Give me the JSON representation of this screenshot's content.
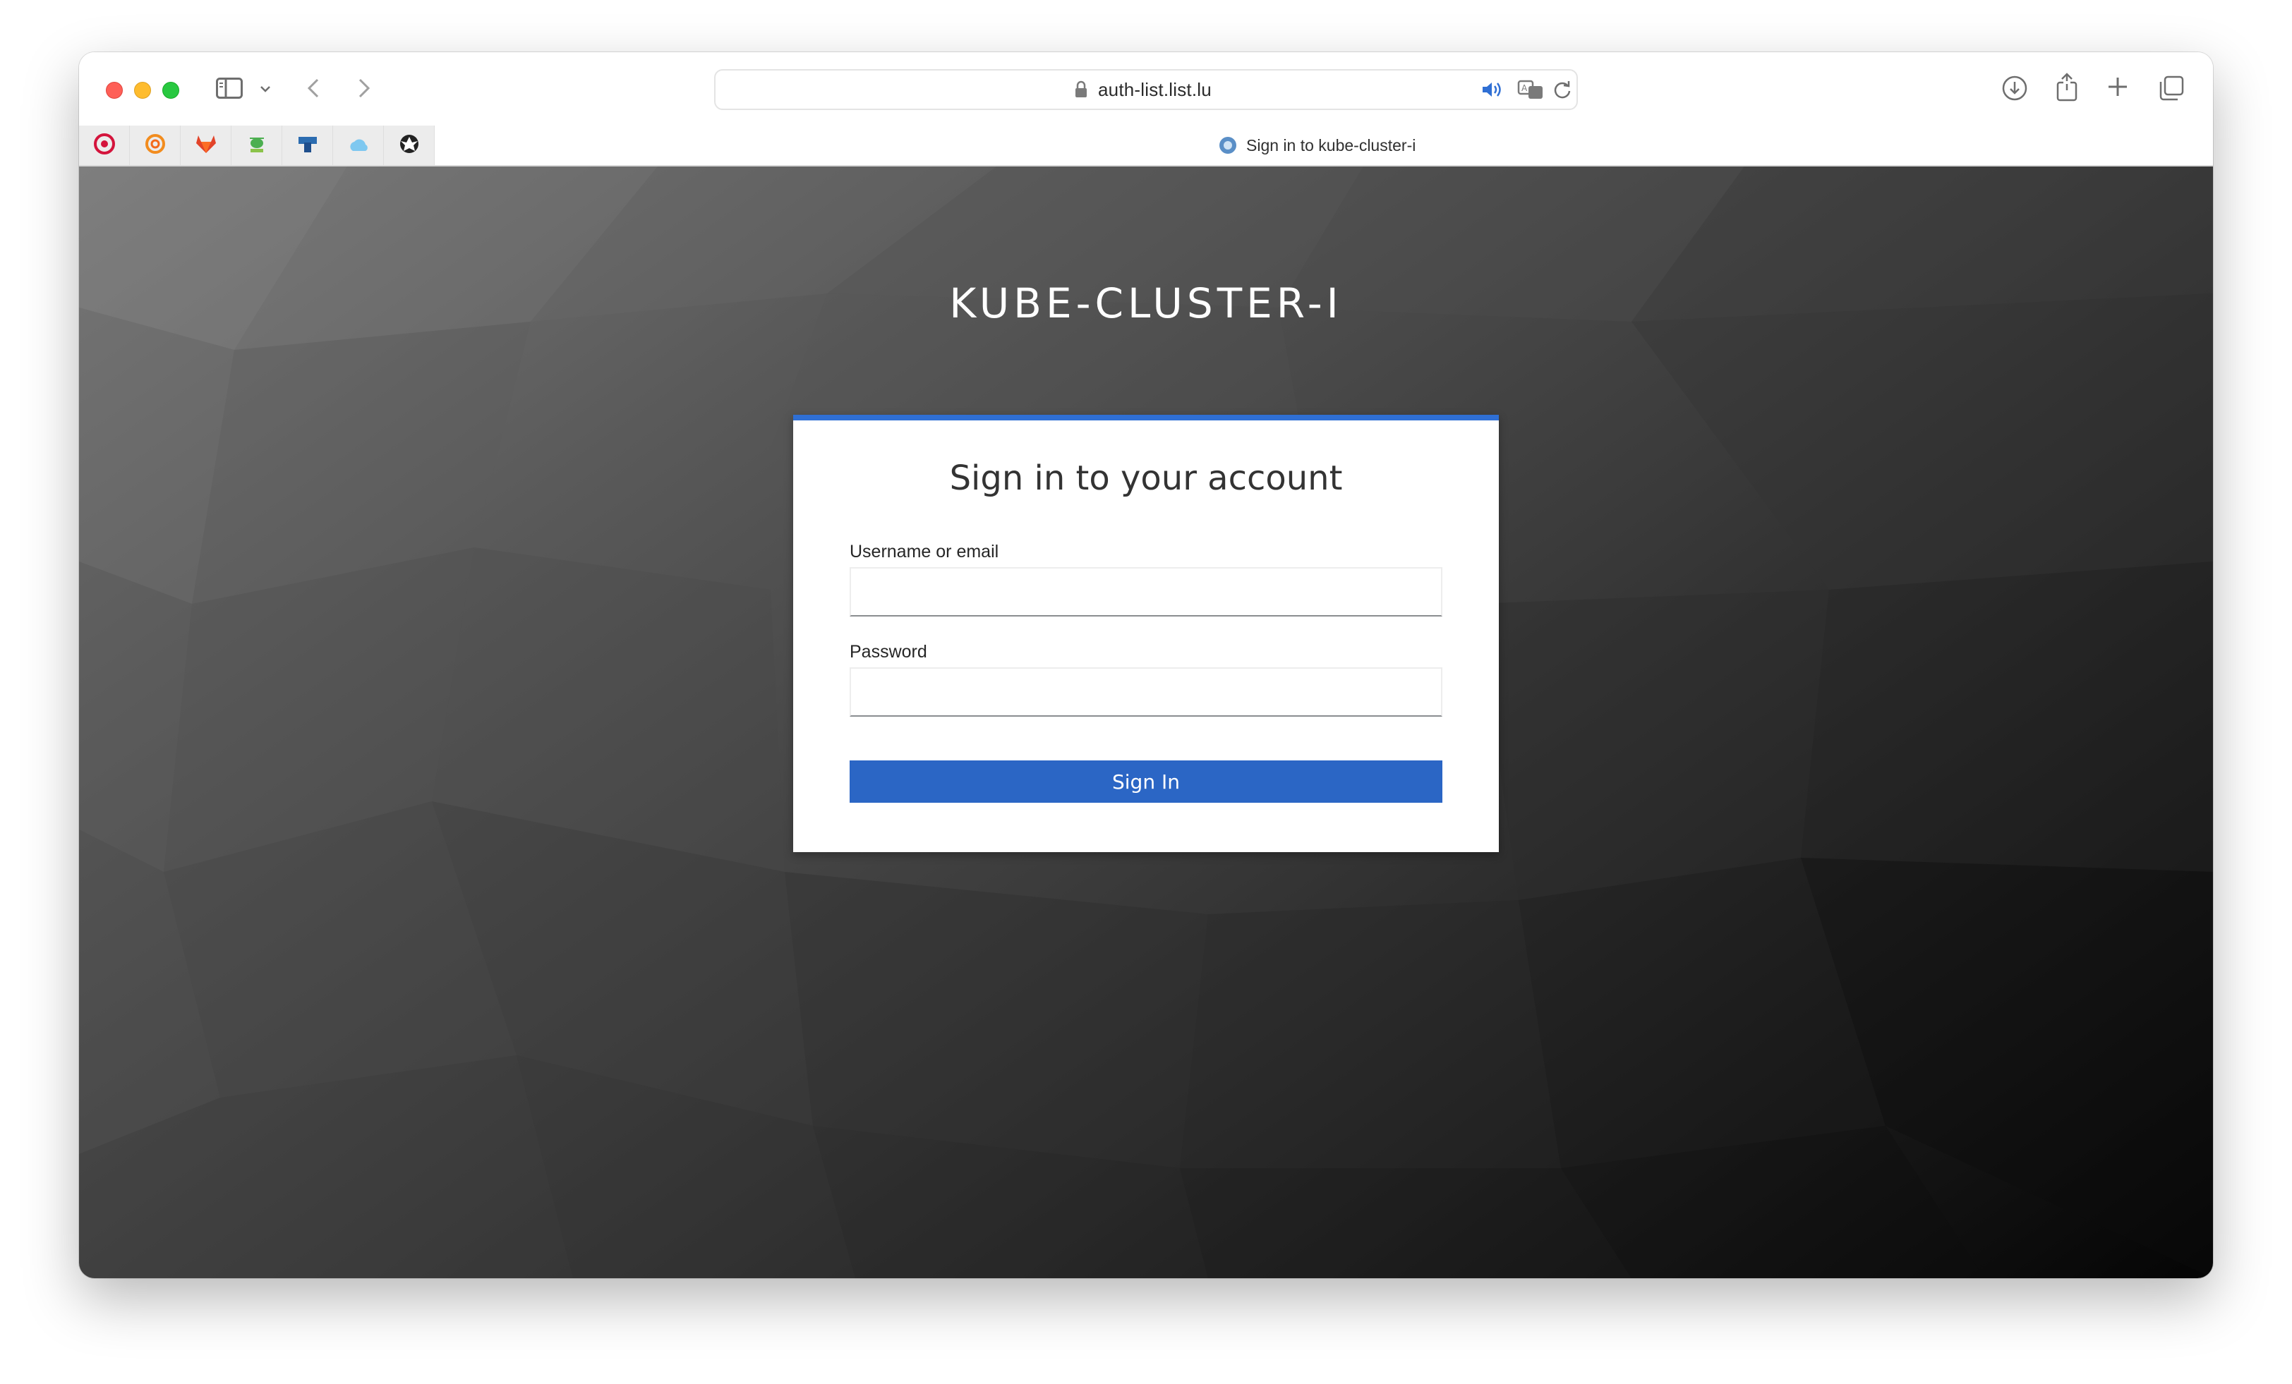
{
  "browser": {
    "url": "auth-list.list.lu",
    "tab_title": "Sign in to kube-cluster-i",
    "favorites": [
      {
        "icon": "red-swirl-icon"
      },
      {
        "icon": "grafana-icon"
      },
      {
        "icon": "gitlab-icon"
      },
      {
        "icon": "green-bug-icon"
      },
      {
        "icon": "blue-tool-icon"
      },
      {
        "icon": "cloud-icon"
      },
      {
        "icon": "eagle-crest-icon"
      }
    ]
  },
  "page": {
    "realm_title": "KUBE-CLUSTER-I",
    "form_title": "Sign in to your account",
    "username_label": "Username or email",
    "username_value": "",
    "password_label": "Password",
    "password_value": "",
    "submit_label": "Sign In"
  },
  "colors": {
    "accent": "#2f6fd4",
    "button": "#2b66c5"
  }
}
